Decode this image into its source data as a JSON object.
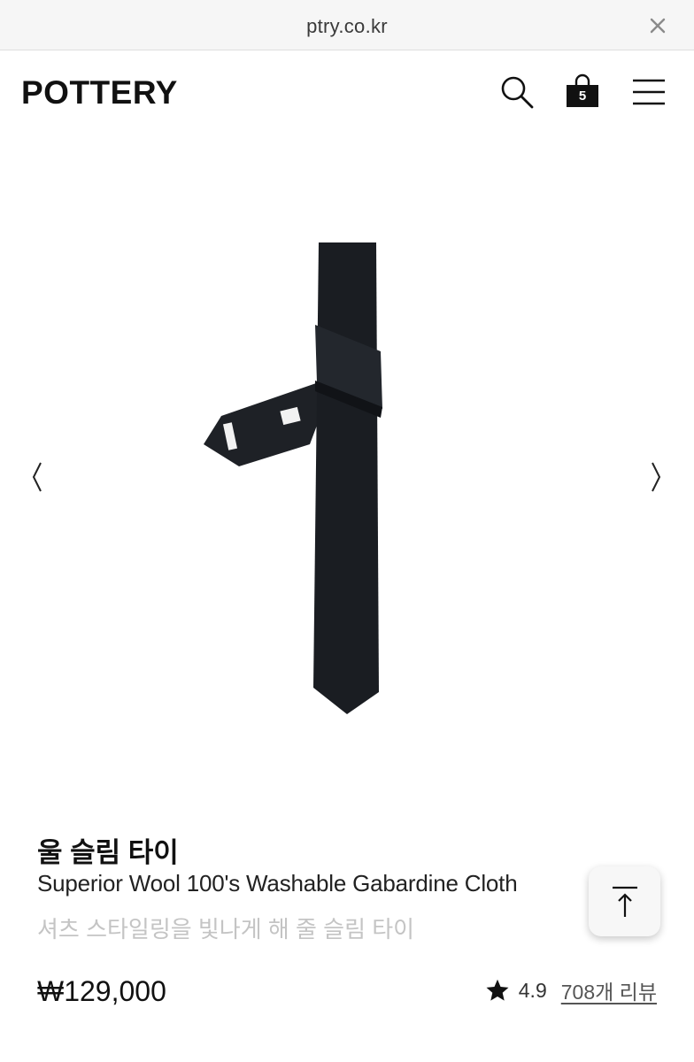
{
  "browser": {
    "url": "ptry.co.kr"
  },
  "header": {
    "logo": "POTTERY",
    "cart_count": "5"
  },
  "product": {
    "name_ko": "울 슬림 타이",
    "name_en": "Superior Wool 100's Washable Gabardine Cloth",
    "tagline": "셔츠 스타일링을 빛나게 해 줄 슬림 타이",
    "price": "₩129,000",
    "rating": "4.9",
    "review_link": "708개 리뷰",
    "image": "black-slim-tie"
  },
  "icons": {
    "close": "close-icon",
    "search": "search-icon",
    "bag": "shopping-bag-icon",
    "menu": "hamburger-menu-icon",
    "prev": "chevron-left-icon",
    "next": "chevron-right-icon",
    "top": "scroll-to-top-icon",
    "star": "star-icon"
  },
  "colors": {
    "text": "#111111",
    "muted": "#c4c4c4",
    "tie": "#1a1d22"
  }
}
